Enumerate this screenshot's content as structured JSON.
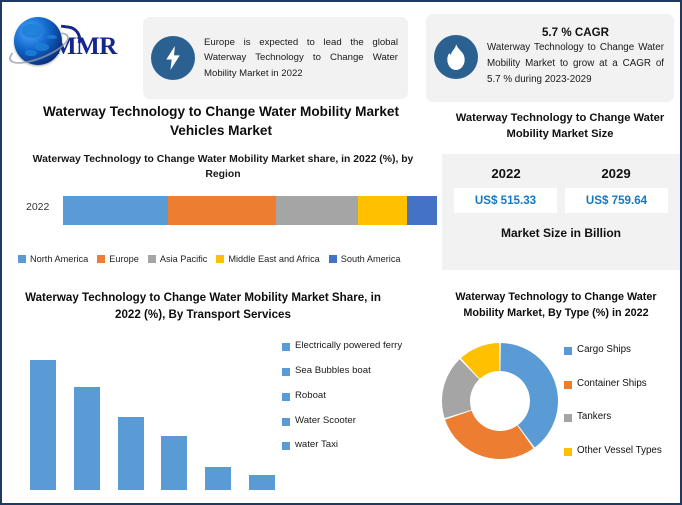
{
  "brand": {
    "name": "MMR",
    "logo_icon": "globe-icon"
  },
  "callouts": [
    {
      "id": "europe",
      "icon": "lightning-bolt-icon",
      "text": "Europe is expected to lead the global Waterway Technology to Change Water Mobility Market in 2022"
    },
    {
      "id": "cagr",
      "icon": "flame-icon",
      "headline": "5.7 % CAGR",
      "text": "Waterway Technology to Change Water Mobility Market to grow at a CAGR of 5.7 % during 2023-2029"
    }
  ],
  "main_title": "Waterway Technology to Change Water Mobility Market Vehicles Market",
  "market_size": {
    "title": "Waterway Technology to Change Water Mobility Market Size",
    "year_a": "2022",
    "year_b": "2029",
    "value_a": "US$ 515.33",
    "value_b": "US$ 759.64",
    "footer": "Market Size in Billion",
    "value_color": "#1379c4"
  },
  "chart_data": [
    {
      "type": "bar",
      "orientation": "horizontal-stacked",
      "title": "Waterway Technology to Change Water Mobility Market share, in 2022 (%), by Region",
      "categories": [
        "2022"
      ],
      "series": [
        {
          "name": "North America",
          "values": [
            28
          ],
          "color": "#5b9bd5"
        },
        {
          "name": "Europe",
          "values": [
            29
          ],
          "color": "#ed7d31"
        },
        {
          "name": "Asia Pacific",
          "values": [
            22
          ],
          "color": "#a5a5a5"
        },
        {
          "name": "Middle East and Africa",
          "values": [
            13
          ],
          "color": "#ffc000"
        },
        {
          "name": "South America",
          "values": [
            8
          ],
          "color": "#4472c4"
        }
      ],
      "xlabel": "",
      "ylabel": "",
      "grid": false,
      "legend": "bottom"
    },
    {
      "type": "bar",
      "title": "Waterway Technology to Change Water Mobility Market Share, in 2022 (%), By Transport Services",
      "categories": [
        "Electrically powered ferry",
        "Sea Bubbles boat",
        "Roboat",
        "Water Scooter",
        "water Taxi",
        ""
      ],
      "values": [
        34,
        27,
        19,
        14,
        6,
        4
      ],
      "color": "#5b9bd5",
      "legend_items": [
        "Electrically powered ferry",
        "Sea Bubbles boat",
        "Roboat",
        "Water Scooter",
        "water Taxi"
      ],
      "xlabel": "",
      "ylabel": "",
      "grid": false,
      "legend": "right"
    },
    {
      "type": "pie",
      "variant": "donut",
      "title": "Waterway Technology to Change Water Mobility Market, By Type (%) in 2022",
      "labels": [
        "Cargo Ships",
        "Container Ships",
        "Tankers",
        "Other Vessel Types"
      ],
      "values": [
        40,
        30,
        18,
        12
      ],
      "colors": [
        "#5b9bd5",
        "#ed7d31",
        "#a5a5a5",
        "#ffc000"
      ],
      "legend": "right"
    }
  ],
  "theme": {
    "border_color": "#1f3864",
    "panel_bg": "#f2f2f2",
    "icon_circle": "#2b6191"
  }
}
